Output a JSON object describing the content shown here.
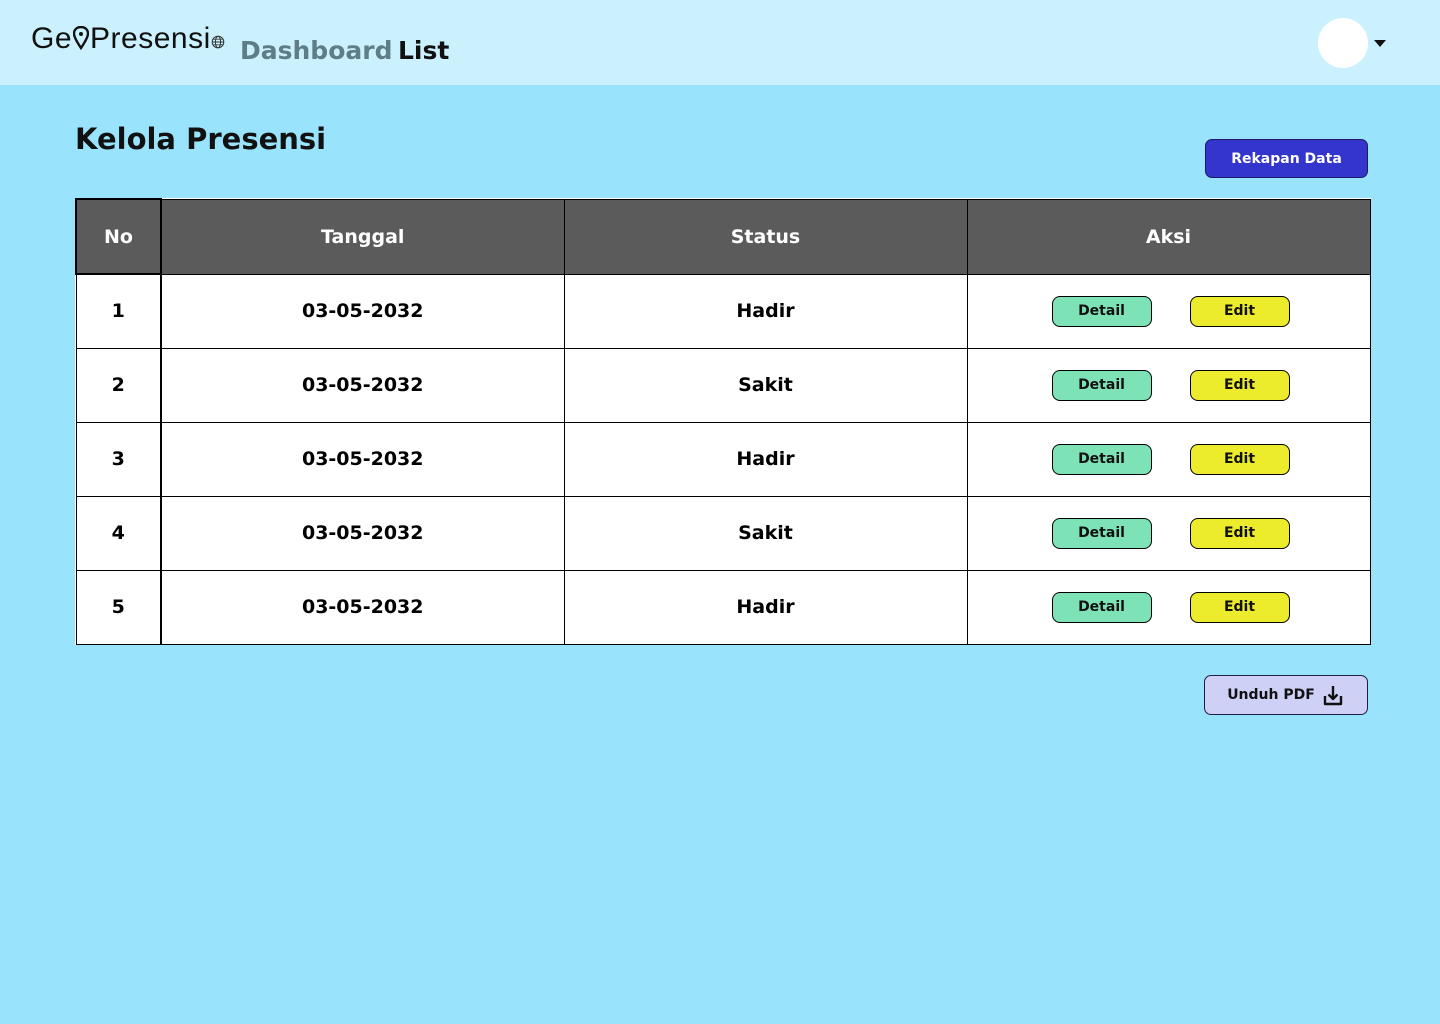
{
  "header": {
    "logo": {
      "part1": "Ge",
      "part2": "Presensi"
    },
    "nav": [
      {
        "label": "Dashboard",
        "active": false
      },
      {
        "label": "List",
        "active": true
      }
    ],
    "user_avatar_icon": "avatar-circle",
    "dropdown_icon": "caret-down-icon"
  },
  "main": {
    "title": "Kelola Presensi",
    "rekap_button": "Rekapan Data",
    "table": {
      "columns": [
        "No",
        "Tanggal",
        "Status",
        "Aksi"
      ],
      "rows": [
        {
          "no": "1",
          "tanggal": "03-05-2032",
          "status": "Hadir",
          "detail": "Detail",
          "edit": "Edit"
        },
        {
          "no": "2",
          "tanggal": "03-05-2032",
          "status": "Sakit",
          "detail": "Detail",
          "edit": "Edit"
        },
        {
          "no": "3",
          "tanggal": "03-05-2032",
          "status": "Hadir",
          "detail": "Detail",
          "edit": "Edit"
        },
        {
          "no": "4",
          "tanggal": "03-05-2032",
          "status": "Sakit",
          "detail": "Detail",
          "edit": "Edit"
        },
        {
          "no": "5",
          "tanggal": "03-05-2032",
          "status": "Hadir",
          "detail": "Detail",
          "edit": "Edit"
        }
      ]
    },
    "download_button": {
      "label": "Unduh PDF",
      "icon": "download-icon"
    }
  },
  "colors": {
    "page_bg": "#9ae3fd",
    "header_bg": "#cbf1fe",
    "table_header_bg": "#5b5b5b",
    "rekap_button": "#3335cc",
    "detail_button": "#7de2b6",
    "edit_button": "#ecec2d",
    "download_button": "#cfd0f5"
  }
}
